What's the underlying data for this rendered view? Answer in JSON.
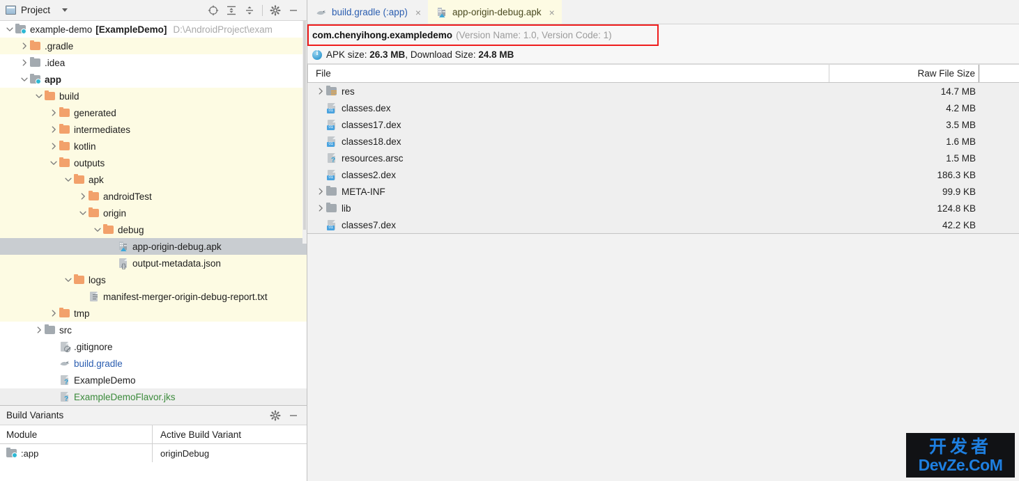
{
  "project_panel": {
    "title": "Project",
    "window_icon": "project-window-icon",
    "toolbar": [
      {
        "name": "locate-target-icon",
        "tooltip": "Select Opened File"
      },
      {
        "name": "expand-all-icon",
        "tooltip": "Expand All"
      },
      {
        "name": "collapse-all-icon",
        "tooltip": "Collapse All"
      },
      {
        "name": "gear-icon",
        "tooltip": "Settings"
      },
      {
        "name": "minimize-icon",
        "tooltip": "Hide"
      }
    ],
    "tree": [
      {
        "label": "example-demo",
        "bold_suffix": "[ExampleDemo]",
        "path": "D:\\AndroidProject\\exam",
        "indent": 0,
        "twist": "down",
        "icon": "module-folder-icon",
        "state": "normal"
      },
      {
        "label": ".gradle",
        "indent": 1,
        "twist": "right",
        "icon": "folder-orange-icon",
        "state": "excluded"
      },
      {
        "label": ".idea",
        "indent": 1,
        "twist": "right",
        "icon": "folder-gray-icon",
        "state": "normal"
      },
      {
        "label": "app",
        "indent": 1,
        "twist": "down",
        "icon": "module-folder-icon",
        "state": "normal",
        "bold": true
      },
      {
        "label": "build",
        "indent": 2,
        "twist": "down",
        "icon": "folder-orange-icon",
        "state": "excluded"
      },
      {
        "label": "generated",
        "indent": 3,
        "twist": "right",
        "icon": "folder-orange-icon",
        "state": "excluded"
      },
      {
        "label": "intermediates",
        "indent": 3,
        "twist": "right",
        "icon": "folder-orange-icon",
        "state": "excluded"
      },
      {
        "label": "kotlin",
        "indent": 3,
        "twist": "right",
        "icon": "folder-orange-icon",
        "state": "excluded"
      },
      {
        "label": "outputs",
        "indent": 3,
        "twist": "down",
        "icon": "folder-orange-icon",
        "state": "excluded"
      },
      {
        "label": "apk",
        "indent": 4,
        "twist": "down",
        "icon": "folder-orange-icon",
        "state": "excluded"
      },
      {
        "label": "androidTest",
        "indent": 5,
        "twist": "right",
        "icon": "folder-orange-icon",
        "state": "excluded"
      },
      {
        "label": "origin",
        "indent": 5,
        "twist": "down",
        "icon": "folder-orange-icon",
        "state": "excluded"
      },
      {
        "label": "debug",
        "indent": 6,
        "twist": "down",
        "icon": "folder-orange-icon",
        "state": "excluded"
      },
      {
        "label": "app-origin-debug.apk",
        "indent": 7,
        "twist": "none",
        "icon": "apk-file-icon",
        "state": "selected"
      },
      {
        "label": "output-metadata.json",
        "indent": 7,
        "twist": "none",
        "icon": "json-file-icon",
        "state": "excluded"
      },
      {
        "label": "logs",
        "indent": 4,
        "twist": "down",
        "icon": "folder-orange-icon",
        "state": "excluded"
      },
      {
        "label": "manifest-merger-origin-debug-report.txt",
        "indent": 5,
        "twist": "none",
        "icon": "text-file-icon",
        "state": "excluded"
      },
      {
        "label": "tmp",
        "indent": 3,
        "twist": "right",
        "icon": "folder-orange-icon",
        "state": "excluded"
      },
      {
        "label": "src",
        "indent": 2,
        "twist": "right",
        "icon": "folder-gray-icon",
        "state": "normal"
      },
      {
        "label": ".gitignore",
        "indent": 3,
        "twist": "none",
        "icon": "gitignore-file-icon",
        "state": "normal"
      },
      {
        "label": "build.gradle",
        "indent": 3,
        "twist": "none",
        "icon": "gradle-file-icon",
        "state": "normal",
        "color": "blue"
      },
      {
        "label": "ExampleDemo",
        "indent": 3,
        "twist": "none",
        "icon": "unknown-file-icon",
        "state": "normal"
      },
      {
        "label": "ExampleDemoFlavor.jks",
        "indent": 3,
        "twist": "none",
        "icon": "unknown-file-icon",
        "state": "band",
        "color": "green"
      }
    ]
  },
  "build_variants": {
    "title": "Build Variants",
    "toolbar": [
      {
        "name": "gear-icon"
      },
      {
        "name": "minimize-icon"
      }
    ],
    "columns": [
      "Module",
      "Active Build Variant"
    ],
    "rows": [
      {
        "module": "app",
        "module_label": ":app",
        "variant": "originDebug",
        "icon": "module-folder-icon"
      }
    ]
  },
  "editor": {
    "tabs": [
      {
        "label": "build.gradle (:app)",
        "icon": "gradle-file-icon",
        "active": false,
        "close": "×"
      },
      {
        "label": "app-origin-debug.apk",
        "icon": "apk-file-icon",
        "active": true,
        "close": "×"
      }
    ],
    "apk_header": {
      "package_name": "com.chenyihong.exampledemo",
      "version_info": "(Version Name: 1.0, Version Code: 1)",
      "highlight_color": "#ef1d1d"
    },
    "apk_size": {
      "prefix": "APK size: ",
      "apk_size": "26.3 MB",
      "middle": ", Download Size: ",
      "download_size": "24.8 MB",
      "icon": "info-icon"
    },
    "file_table": {
      "columns": [
        "File",
        "Raw File Size"
      ],
      "rows": [
        {
          "name": "res",
          "size": "14.7 MB",
          "twist": "right",
          "icon": "res-folder-icon"
        },
        {
          "name": "classes.dex",
          "size": "4.2 MB",
          "twist": "none",
          "icon": "dex-file-icon"
        },
        {
          "name": "classes17.dex",
          "size": "3.5 MB",
          "twist": "none",
          "icon": "dex-file-icon"
        },
        {
          "name": "classes18.dex",
          "size": "1.6 MB",
          "twist": "none",
          "icon": "dex-file-icon"
        },
        {
          "name": "resources.arsc",
          "size": "1.5 MB",
          "twist": "none",
          "icon": "unknown-file-icon"
        },
        {
          "name": "classes2.dex",
          "size": "186.3 KB",
          "twist": "none",
          "icon": "dex-file-icon"
        },
        {
          "name": "META-INF",
          "size": "99.9 KB",
          "twist": "right",
          "icon": "folder-gray-icon"
        },
        {
          "name": "lib",
          "size": "124.8 KB",
          "twist": "right",
          "icon": "folder-gray-icon"
        },
        {
          "name": "classes7.dex",
          "size": "42.2 KB",
          "twist": "none",
          "icon": "dex-file-icon"
        }
      ]
    }
  },
  "watermark": {
    "cn": "开发者",
    "en": "DevZe.CoM",
    "color": "#1e7fe0"
  }
}
